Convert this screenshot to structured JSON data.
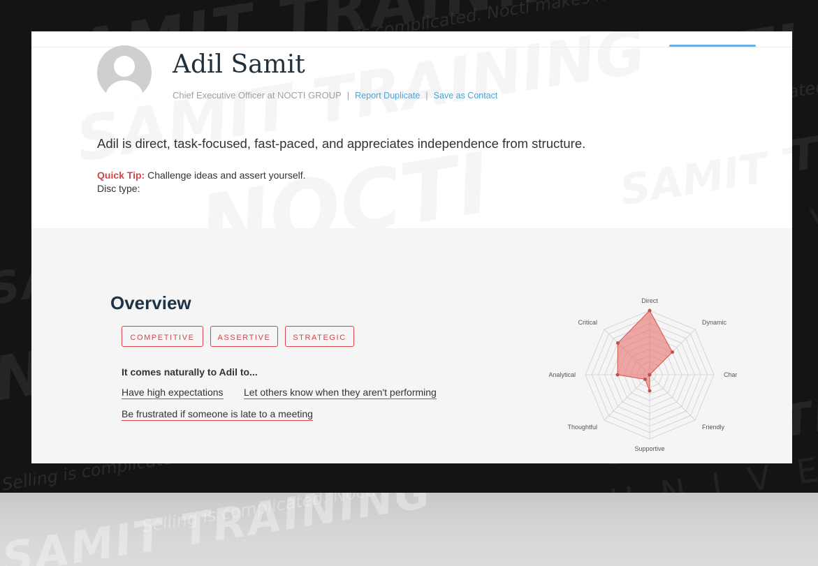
{
  "profile": {
    "name": "Adil Samit",
    "title": "Chief Executive Officer at NOCTI GROUP",
    "separator": "|",
    "report_duplicate": "Report Duplicate",
    "save_contact": "Save as Contact",
    "summary": "Adil is direct, task-focused, fast-paced, and appreciates independence from structure.",
    "quick_tip_label": "Quick Tip:",
    "quick_tip_text": " Challenge ideas and assert yourself.",
    "disc_type_label": "Disc type:"
  },
  "overview": {
    "title": "Overview",
    "tags": [
      "COMPETITIVE",
      "ASSERTIVE",
      "STRATEGIC"
    ],
    "naturally_label": "It comes naturally to Adil to...",
    "traits": [
      "Have high expectations",
      "Let others know when they aren't performing",
      "Be frustrated if someone is late to a meeting"
    ]
  },
  "watermark": {
    "brand": "SAMIT TRAINING",
    "word": "NOCTI",
    "university": "UNIVERSITY",
    "slogan": "Selling is complicated. Nocti makes it easy."
  },
  "chart_data": {
    "type": "radar",
    "axes": [
      "Direct",
      "Dynamic",
      "Charming",
      "Friendly",
      "Supportive",
      "Thoughtful",
      "Analytical",
      "Critical"
    ],
    "values": [
      1.0,
      0.5,
      0.0,
      0.0,
      0.25,
      0.1,
      0.5,
      0.7
    ],
    "range": [
      0,
      1
    ],
    "rings": 10,
    "fill_color": "#e8706e",
    "grid": true
  }
}
